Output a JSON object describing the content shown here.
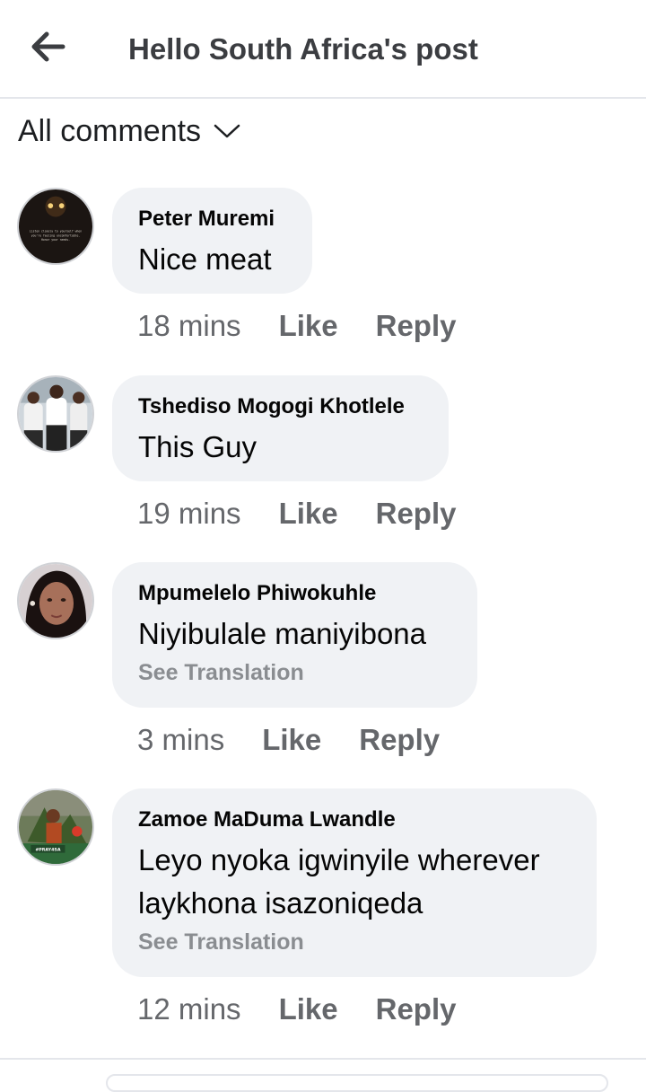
{
  "header": {
    "title": "Hello South Africa's post"
  },
  "filter": {
    "label": "All comments"
  },
  "comments": [
    {
      "author": "Peter Muremi",
      "text": "Nice meat",
      "time": "18 mins",
      "like": "Like",
      "reply": "Reply"
    },
    {
      "author": "Tshediso Mogogi Khotlele",
      "text": "This Guy",
      "time": "19 mins",
      "like": "Like",
      "reply": "Reply"
    },
    {
      "author": "Mpumelelo Phiwokuhle",
      "text": "Niyibulale maniyibona",
      "see_translation": "See Translation",
      "time": "3 mins",
      "like": "Like",
      "reply": "Reply"
    },
    {
      "author": "Zamoe MaDuma Lwandle",
      "text_line1": "Leyo nyoka igwinyile wherever",
      "text_line2": "laykhona isazoniqeda",
      "see_translation": "See Translation",
      "time": "12 mins",
      "like": "Like",
      "reply": "Reply"
    }
  ],
  "avatars": {
    "c1": {
      "caption_l1": "Listen closely to yourself when",
      "caption_l2": "you're feeling uncomfortable.",
      "caption_l3": "Honor your needs."
    },
    "c4": {
      "badge": "#PRAY4SA"
    }
  },
  "colors": {
    "bubble": "#f0f2f5",
    "meta": "#65676b",
    "muted": "#8a8d91"
  }
}
